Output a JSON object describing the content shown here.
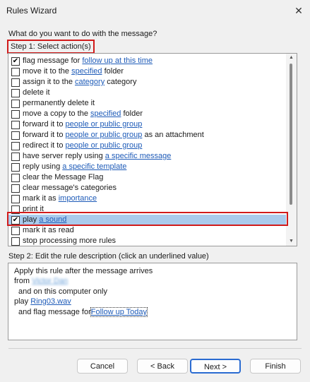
{
  "window": {
    "title": "Rules Wizard",
    "close_glyph": "✕"
  },
  "question": "What do you want to do with the message?",
  "step1_label": "Step 1: Select action(s)",
  "actions": [
    {
      "checked": true,
      "parts": [
        {
          "t": "flag message for "
        },
        {
          "t": "follow up at this time",
          "link": true
        }
      ]
    },
    {
      "checked": false,
      "parts": [
        {
          "t": "move it to the "
        },
        {
          "t": "specified",
          "link": true
        },
        {
          "t": " folder"
        }
      ]
    },
    {
      "checked": false,
      "parts": [
        {
          "t": "assign it to the "
        },
        {
          "t": "category",
          "link": true
        },
        {
          "t": " category"
        }
      ]
    },
    {
      "checked": false,
      "parts": [
        {
          "t": "delete it"
        }
      ]
    },
    {
      "checked": false,
      "parts": [
        {
          "t": "permanently delete it"
        }
      ]
    },
    {
      "checked": false,
      "parts": [
        {
          "t": "move a copy to the "
        },
        {
          "t": "specified",
          "link": true
        },
        {
          "t": " folder"
        }
      ]
    },
    {
      "checked": false,
      "parts": [
        {
          "t": "forward it to "
        },
        {
          "t": "people or public group",
          "link": true
        }
      ]
    },
    {
      "checked": false,
      "parts": [
        {
          "t": "forward it to "
        },
        {
          "t": "people or public group",
          "link": true
        },
        {
          "t": " as an attachment"
        }
      ]
    },
    {
      "checked": false,
      "parts": [
        {
          "t": "redirect it to "
        },
        {
          "t": "people or public group",
          "link": true
        }
      ]
    },
    {
      "checked": false,
      "parts": [
        {
          "t": "have server reply using "
        },
        {
          "t": "a specific message",
          "link": true
        }
      ]
    },
    {
      "checked": false,
      "parts": [
        {
          "t": "reply using "
        },
        {
          "t": "a specific template",
          "link": true
        }
      ]
    },
    {
      "checked": false,
      "parts": [
        {
          "t": "clear the Message Flag"
        }
      ]
    },
    {
      "checked": false,
      "parts": [
        {
          "t": "clear message's categories"
        }
      ]
    },
    {
      "checked": false,
      "parts": [
        {
          "t": "mark it as "
        },
        {
          "t": "importance",
          "link": true
        }
      ]
    },
    {
      "checked": false,
      "parts": [
        {
          "t": "print it"
        }
      ]
    },
    {
      "checked": true,
      "selected": true,
      "parts": [
        {
          "t": "play "
        },
        {
          "t": "a sound",
          "link": true
        }
      ]
    },
    {
      "checked": false,
      "parts": [
        {
          "t": "mark it as read"
        }
      ]
    },
    {
      "checked": false,
      "parts": [
        {
          "t": "stop processing more rules"
        }
      ]
    }
  ],
  "step2_label": "Step 2: Edit the rule description (click an underlined value)",
  "description": {
    "line1": "Apply this rule after the message arrives",
    "line2_prefix": "from",
    "line2_value": "Victor Dan",
    "line3": "and on this computer only",
    "line4_prefix": "play",
    "line4_value": "Ring03.wav",
    "line5_prefix": "and flag message for",
    "line5_value": "Follow up Today"
  },
  "buttons": {
    "cancel": "Cancel",
    "back": "< Back",
    "next": "Next >",
    "finish": "Finish"
  }
}
